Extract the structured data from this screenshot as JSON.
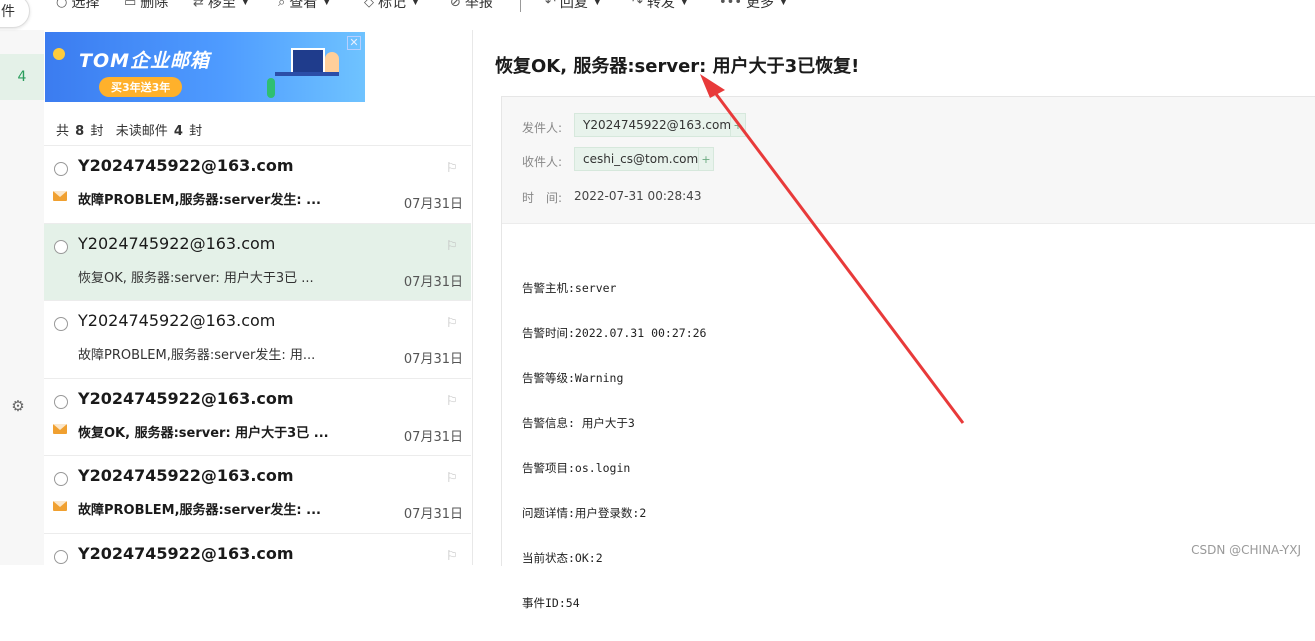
{
  "toolbar": {
    "items": [
      {
        "label": "选择",
        "icon": "circle-icon"
      },
      {
        "label": "删除",
        "icon": "trash-icon"
      },
      {
        "label": "移至",
        "icon": "move-icon"
      },
      {
        "label": "查看",
        "icon": "view-icon"
      },
      {
        "label": "标记",
        "icon": "tag-icon"
      },
      {
        "label": "举报",
        "icon": "report-icon"
      },
      {
        "label": "回复",
        "icon": "reply-icon"
      },
      {
        "label": "转发",
        "icon": "forward-icon"
      },
      {
        "label": "更多",
        "icon": "more-icon"
      }
    ]
  },
  "left": {
    "compose_partial": "件",
    "active_count": "4"
  },
  "banner": {
    "brand": "TOM企业邮箱",
    "promo": "买3年送3年"
  },
  "summary": {
    "total_prefix": "共",
    "total": "8",
    "total_suffix": "封",
    "unread_prefix": "未读邮件",
    "unread": "4",
    "unread_suffix": "封"
  },
  "mails": [
    {
      "sender": "Y2024745922@163.com",
      "subject": "故障PROBLEM,服务器:server发生: ...",
      "date": "07月31日",
      "unread": true,
      "selected": false
    },
    {
      "sender": "Y2024745922@163.com",
      "subject": "恢复OK, 服务器:server: 用户大于3已 ...",
      "date": "07月31日",
      "unread": false,
      "selected": true
    },
    {
      "sender": "Y2024745922@163.com",
      "subject": "故障PROBLEM,服务器:server发生: 用...",
      "date": "07月31日",
      "unread": false,
      "selected": false
    },
    {
      "sender": "Y2024745922@163.com",
      "subject": "恢复OK, 服务器:server: 用户大于3已 ...",
      "date": "07月31日",
      "unread": true,
      "selected": false
    },
    {
      "sender": "Y2024745922@163.com",
      "subject": "故障PROBLEM,服务器:server发生: ...",
      "date": "07月31日",
      "unread": true,
      "selected": false
    },
    {
      "sender": "Y2024745922@163.com",
      "subject": "",
      "date": "",
      "unread": true,
      "selected": false
    }
  ],
  "mail": {
    "title": "恢复OK, 服务器:server: 用户大于3已恢复!",
    "from_label": "发件人:",
    "from": "Y2024745922@163.com",
    "to_label": "收件人:",
    "to": "ceshi_cs@tom.com",
    "time_label": "时　间:",
    "time": "2022-07-31 00:28:43",
    "plus": "+",
    "body": [
      "告警主机:server",
      "告警时间:2022.07.31 00:27:26",
      "告警等级:Warning",
      "告警信息: 用户大于3",
      "告警项目:os.login",
      "问题详情:用户登录数:2",
      "当前状态:OK:2",
      "事件ID:54"
    ]
  },
  "watermark": "CSDN @CHINA-YXJ",
  "colors": {
    "accent_green": "#2a9d5c",
    "selected_bg": "#e4f1e8",
    "annotation_red": "#e83a3a",
    "unread_envelope": "#f0a030"
  }
}
